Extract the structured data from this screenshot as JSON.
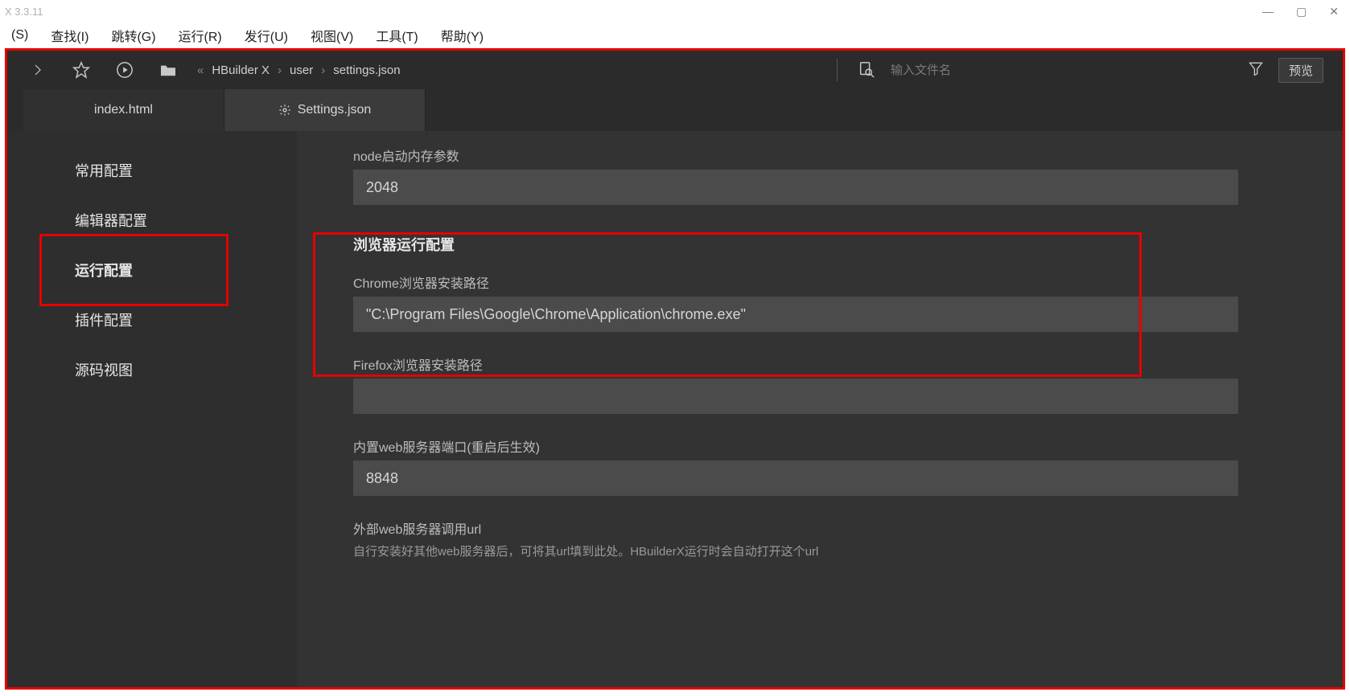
{
  "titlebar": {
    "version": "X 3.3.11"
  },
  "menus": [
    "(S)",
    "查找(I)",
    "跳转(G)",
    "运行(R)",
    "发行(U)",
    "视图(V)",
    "工具(T)",
    "帮助(Y)"
  ],
  "breadcrumb": {
    "root": "HBuilder X",
    "mid": "user",
    "leaf": "settings.json"
  },
  "search": {
    "placeholder": "输入文件名"
  },
  "toolbar": {
    "preview": "预览"
  },
  "tabs": [
    {
      "label": "index.html",
      "active": false
    },
    {
      "label": "Settings.json",
      "active": true,
      "icon": "gear"
    }
  ],
  "sidebar": {
    "items": [
      {
        "label": "常用配置"
      },
      {
        "label": "编辑器配置"
      },
      {
        "label": "运行配置",
        "active": true
      },
      {
        "label": "插件配置"
      },
      {
        "label": "源码视图"
      }
    ]
  },
  "settings": {
    "nodeMemory": {
      "label": "node启动内存参数",
      "value": "2048"
    },
    "browserSection": "浏览器运行配置",
    "chromePath": {
      "label": "Chrome浏览器安装路径",
      "value": "\"C:\\Program Files\\Google\\Chrome\\Application\\chrome.exe\""
    },
    "firefoxPath": {
      "label": "Firefox浏览器安装路径",
      "value": ""
    },
    "webPort": {
      "label": "内置web服务器端口(重启后生效)",
      "value": "8848"
    },
    "externalUrl": {
      "label": "外部web服务器调用url",
      "hint": "自行安装好其他web服务器后，可将其url填到此处。HBuilderX运行时会自动打开这个url",
      "value": ""
    }
  }
}
